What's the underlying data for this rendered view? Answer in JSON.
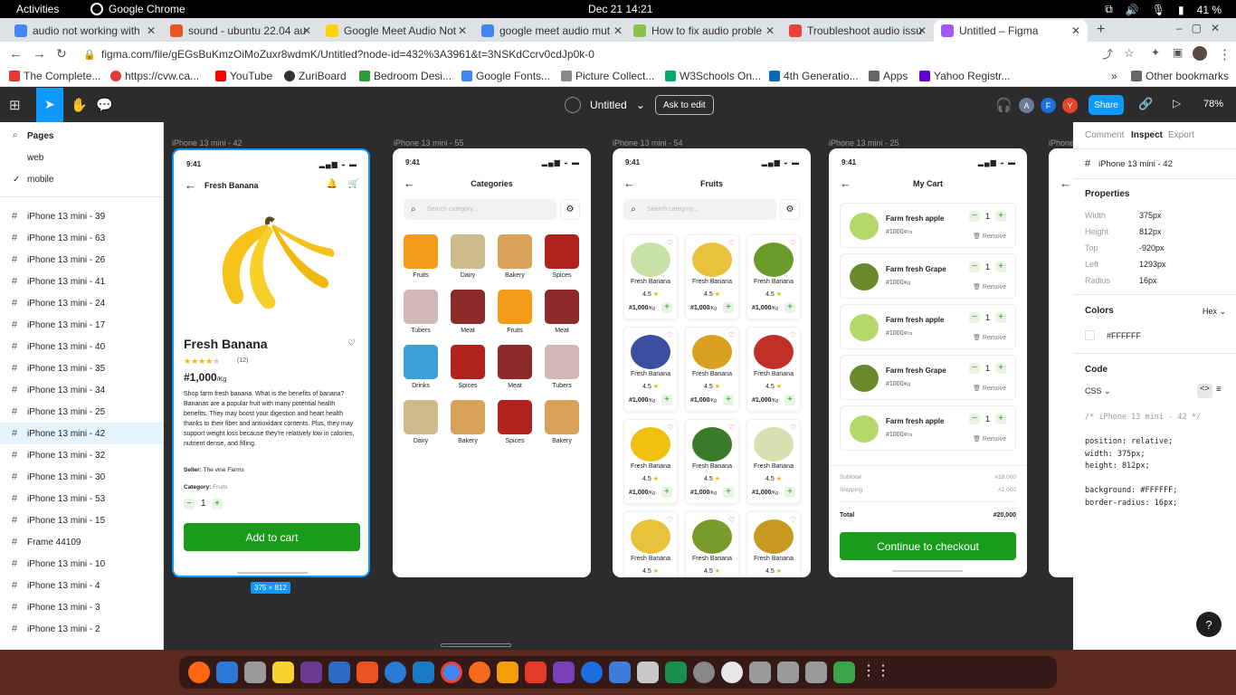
{
  "system": {
    "activities": "Activities",
    "app": "Google Chrome",
    "datetime": "Dec 21  14:21",
    "battery": "41 %"
  },
  "tabs": [
    {
      "label": "audio not working with",
      "color": "#4285f4"
    },
    {
      "label": "sound - ubuntu 22.04 au",
      "color": "#e95420"
    },
    {
      "label": "Google Meet Audio Not",
      "color": "#ffd400"
    },
    {
      "label": "google meet audio mut",
      "color": "#4285f4"
    },
    {
      "label": "How to fix audio proble",
      "color": "#8bc34a"
    },
    {
      "label": "Troubleshoot audio issu",
      "color": "#ea4335"
    },
    {
      "label": "Untitled – Figma",
      "color": "#a259ff"
    }
  ],
  "url": "figma.com/file/gEGsBuKmzOiMoZuxr8wdmK/Untitled?node-id=432%3A3961&t=3NSKdCcrv0cdJp0k-0",
  "bookmarks": [
    "The Complete...",
    "https://cvw.ca...",
    "YouTube",
    "ZuriBoard",
    "Bedroom Desi...",
    "Google Fonts...",
    "Picture Collect...",
    "W3Schools On...",
    "4th Generatio...",
    "Apps",
    "Yahoo Registr...",
    "Other bookmarks"
  ],
  "figma": {
    "doc_name": "Untitled",
    "ask": "Ask to edit",
    "avatars": [
      "A",
      "F",
      "Y"
    ],
    "share": "Share",
    "zoom": "78%",
    "pages_title": "Pages",
    "pages": [
      "web",
      "mobile"
    ],
    "layers": [
      "iPhone 13 mini - 39",
      "iPhone 13 mini - 63",
      "iPhone 13 mini - 26",
      "iPhone 13 mini - 41",
      "iPhone 13 mini - 24",
      "iPhone 13 mini - 17",
      "iPhone 13 mini - 40",
      "iPhone 13 mini - 35",
      "iPhone 13 mini - 34",
      "iPhone 13 mini - 25",
      "iPhone 13 mini - 42",
      "iPhone 13 mini - 32",
      "iPhone 13 mini - 30",
      "iPhone 13 mini - 53",
      "iPhone 13 mini - 15",
      "Frame 44109",
      "iPhone 13 mini - 10",
      "iPhone 13 mini - 4",
      "iPhone 13 mini - 3",
      "iPhone 13 mini - 2"
    ],
    "frame_labels": [
      "iPhone 13 mini - 42",
      "iPhone 13 mini - 55",
      "iPhone 13 mini - 54",
      "iPhone 13 mini - 25",
      "iPhone"
    ],
    "size_badge": "375 × 812"
  },
  "phone_time": "9:41",
  "product": {
    "header": "Fresh Banana",
    "name": "Fresh Banana",
    "reviews": "(12)",
    "price": "#1,000",
    "unit": "/Kg",
    "description": "Shop farm fresh banana. What is the benefits of banana? Bananas are a popular fruit with many potential health benefits. They may boost your digestion and heart health thanks to their fiber and antioxidant contents. Plus, they may support weight loss because they're relatively low in calories, nutrient dense, and filling.",
    "seller_label": "Seller:",
    "seller": "The vine Farms",
    "category_label": "Category:",
    "category": "Fruits",
    "qty": "1",
    "add_btn": "Add to cart"
  },
  "categories": {
    "title": "Categories",
    "search": "Search category...",
    "items": [
      "Fruits",
      "Dairy",
      "Bakery",
      "Spices",
      "Tubers",
      "Meat",
      "Fruits",
      "Meat",
      "Drinks",
      "Spices",
      "Meat",
      "Tubers",
      "Dairy",
      "Bakery",
      "Spices",
      "Bakery"
    ]
  },
  "fruits": {
    "title": "Fruits",
    "search": "Search category...",
    "card_name": "Fresh Banana",
    "rating": "4.5",
    "price": "#1,000",
    "unit": "/Kg"
  },
  "cart": {
    "title": "My Cart",
    "items": [
      {
        "name": "Farm fresh apple",
        "price": "#1000",
        "unit": "/Pcs",
        "qty": "1"
      },
      {
        "name": "Farm fresh Grape",
        "price": "#1000",
        "unit": "/Kg",
        "qty": "1"
      },
      {
        "name": "Farm fresh apple",
        "price": "#1000",
        "unit": "/Pcs",
        "qty": "1"
      },
      {
        "name": "Farm fresh Grape",
        "price": "#1000",
        "unit": "/Kg",
        "qty": "1"
      },
      {
        "name": "Farm fresh apple",
        "price": "#1000",
        "unit": "/Pcs",
        "qty": "1"
      }
    ],
    "remove": "Remove",
    "subtotal_label": "Subtotal",
    "subtotal": "#18,000",
    "shipping_label": "Shipping",
    "shipping": "#2,000",
    "total_label": "Total",
    "total": "#20,000",
    "checkout": "Continue to checkout"
  },
  "inspect": {
    "tabs": [
      "Comment",
      "Inspect",
      "Export"
    ],
    "frame": "iPhone 13 mini - 42",
    "properties_title": "Properties",
    "props": [
      {
        "k": "Width",
        "v": "375px"
      },
      {
        "k": "Height",
        "v": "812px"
      },
      {
        "k": "Top",
        "v": "-920px"
      },
      {
        "k": "Left",
        "v": "1293px"
      },
      {
        "k": "Radius",
        "v": "16px"
      }
    ],
    "colors_title": "Colors",
    "color_mode": "Hex",
    "color_value": "#FFFFFF",
    "code_title": "Code",
    "code_lang": "CSS",
    "code_lines": [
      "/* iPhone 13 mini - 42 */",
      "",
      "position: relative;",
      "width: 375px;",
      "height: 812px;",
      "",
      "background: #FFFFFF;",
      "border-radius: 16px;"
    ]
  }
}
